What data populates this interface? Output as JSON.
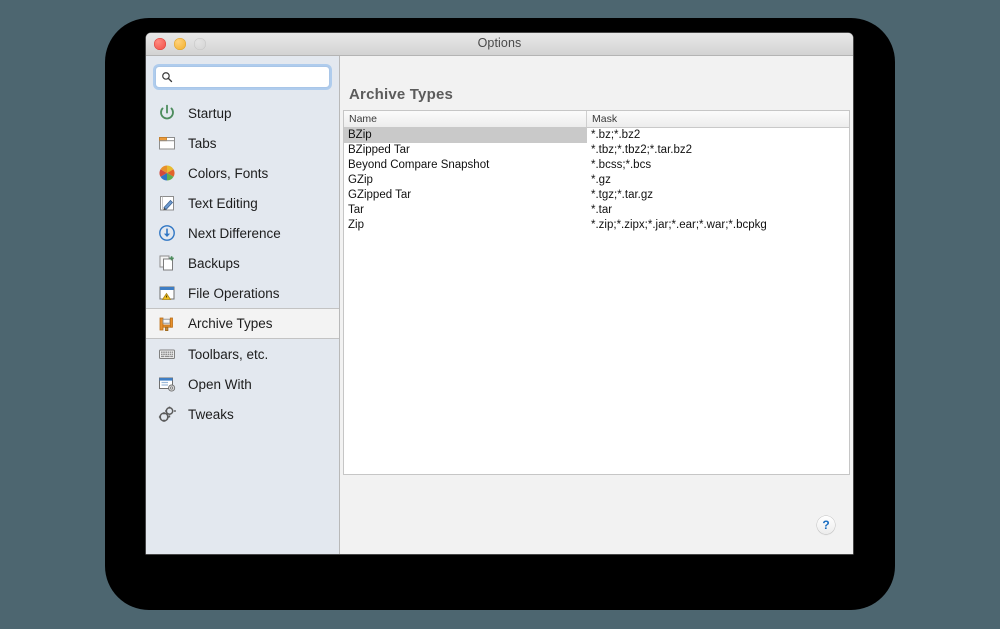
{
  "window": {
    "title": "Options",
    "traffic_lights": [
      {
        "name": "close-button",
        "color": "#f04a42"
      },
      {
        "name": "minimize-button",
        "color": "#f2ad26"
      },
      {
        "name": "zoom-button",
        "color": "#d2d2d2"
      }
    ]
  },
  "search": {
    "value": "",
    "placeholder": ""
  },
  "sidebar": {
    "items": [
      {
        "label": "Startup",
        "icon": "power-icon",
        "selected": false
      },
      {
        "label": "Tabs",
        "icon": "tabs-icon",
        "selected": false
      },
      {
        "label": "Colors, Fonts",
        "icon": "color-wheel-icon",
        "selected": false
      },
      {
        "label": "Text Editing",
        "icon": "notepad-pencil-icon",
        "selected": false
      },
      {
        "label": "Next Difference",
        "icon": "arrow-down-circle-icon",
        "selected": false
      },
      {
        "label": "Backups",
        "icon": "copy-plus-icon",
        "selected": false
      },
      {
        "label": "File Operations",
        "icon": "window-warning-icon",
        "selected": false
      },
      {
        "label": "Archive Types",
        "icon": "clamp-icon",
        "selected": true
      },
      {
        "label": "Toolbars, etc.",
        "icon": "keyboard-icon",
        "selected": false
      },
      {
        "label": "Open With",
        "icon": "window-gear-icon",
        "selected": false
      },
      {
        "label": "Tweaks",
        "icon": "gears-icon",
        "selected": false
      }
    ]
  },
  "pane": {
    "title": "Archive Types",
    "table": {
      "columns": [
        "Name",
        "Mask"
      ],
      "rows": [
        {
          "name": "BZip",
          "mask": "*.bz;*.bz2",
          "selected": true
        },
        {
          "name": "BZipped Tar",
          "mask": "*.tbz;*.tbz2;*.tar.bz2",
          "selected": false
        },
        {
          "name": "Beyond Compare Snapshot",
          "mask": "*.bcss;*.bcs",
          "selected": false
        },
        {
          "name": "GZip",
          "mask": "*.gz",
          "selected": false
        },
        {
          "name": "GZipped Tar",
          "mask": "*.tgz;*.tar.gz",
          "selected": false
        },
        {
          "name": "Tar",
          "mask": "*.tar",
          "selected": false
        },
        {
          "name": "Zip",
          "mask": "*.zip;*.zipx;*.jar;*.ear;*.war;*.bcpkg",
          "selected": false
        }
      ]
    }
  },
  "help": {
    "label": "?"
  },
  "colors": {
    "desktop_background": "#4d6670",
    "sidebar_background": "#e3e8ef",
    "selection_gray": "#c9c9c9",
    "help_blue": "#1b6ec2",
    "accent_orange": "#e8912c"
  }
}
